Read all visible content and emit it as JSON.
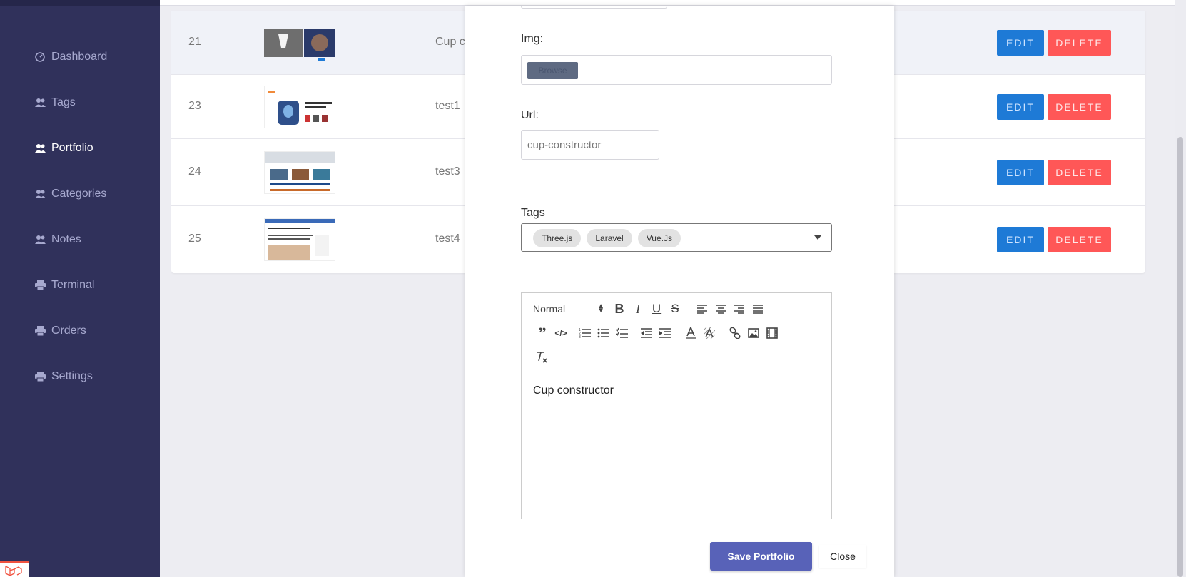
{
  "sidebar": {
    "items": [
      {
        "label": "Dashboard",
        "icon": "dashboard-icon",
        "active": false
      },
      {
        "label": "Tags",
        "icon": "users-icon",
        "active": false
      },
      {
        "label": "Portfolio",
        "icon": "users-icon",
        "active": true
      },
      {
        "label": "Categories",
        "icon": "users-icon",
        "active": false
      },
      {
        "label": "Notes",
        "icon": "users-icon",
        "active": false
      },
      {
        "label": "Terminal",
        "icon": "printer-icon",
        "active": false
      },
      {
        "label": "Orders",
        "icon": "printer-icon",
        "active": false
      },
      {
        "label": "Settings",
        "icon": "printer-icon",
        "active": false
      }
    ]
  },
  "table": {
    "rows": [
      {
        "id": "21",
        "name": "Cup co",
        "highlighted": true
      },
      {
        "id": "23",
        "name": "test1",
        "highlighted": false
      },
      {
        "id": "24",
        "name": "test3",
        "highlighted": false
      },
      {
        "id": "25",
        "name": "test4",
        "highlighted": false
      }
    ],
    "edit_label": "EDIT",
    "delete_label": "DELETE"
  },
  "modal": {
    "img_label": "Img:",
    "browse_label": "Browse",
    "url_label": "Url:",
    "url_value": "cup-constructor",
    "tags_label": "Tags",
    "tags": [
      "Three.js",
      "Laravel",
      "Vue.Js"
    ],
    "editor": {
      "format_value": "Normal",
      "content": "Cup constructor"
    },
    "save_label": "Save Portfolio",
    "close_label": "Close"
  },
  "colors": {
    "sidebar_bg": "#30315b",
    "edit_button": "#1e7ad6",
    "delete_button": "#ff5757",
    "save_button": "#5862b8"
  }
}
